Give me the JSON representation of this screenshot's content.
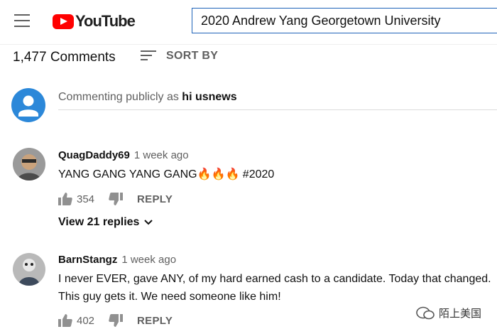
{
  "header": {
    "logo_text": "YouTube",
    "search_value": "2020 Andrew Yang Georgetown University"
  },
  "comments_header": {
    "count_label": "1,477 Comments",
    "sort_label": "SORT BY"
  },
  "composer": {
    "prefix": "Commenting publicly as ",
    "username": "hi usnews"
  },
  "comments": [
    {
      "author": "QuagDaddy69",
      "time": "1 week ago",
      "text": "YANG GANG YANG GANG🔥🔥🔥 #2020",
      "likes": "354",
      "reply_label": "REPLY",
      "view_replies": "View 21 replies"
    },
    {
      "author": "BarnStangz",
      "time": "1 week ago",
      "text_line1": "I never EVER, gave ANY, of my hard earned cash to a candidate. Today that changed.",
      "text_line2": "This guy gets it. We need someone like him!",
      "likes": "402",
      "reply_label": "REPLY"
    }
  ],
  "watermark": {
    "text": "陌上美国"
  },
  "colors": {
    "brand_red": "#ff0000",
    "search_border": "#1c62b9",
    "avatar_blue": "#2c88d9",
    "secondary_text": "#606060"
  }
}
